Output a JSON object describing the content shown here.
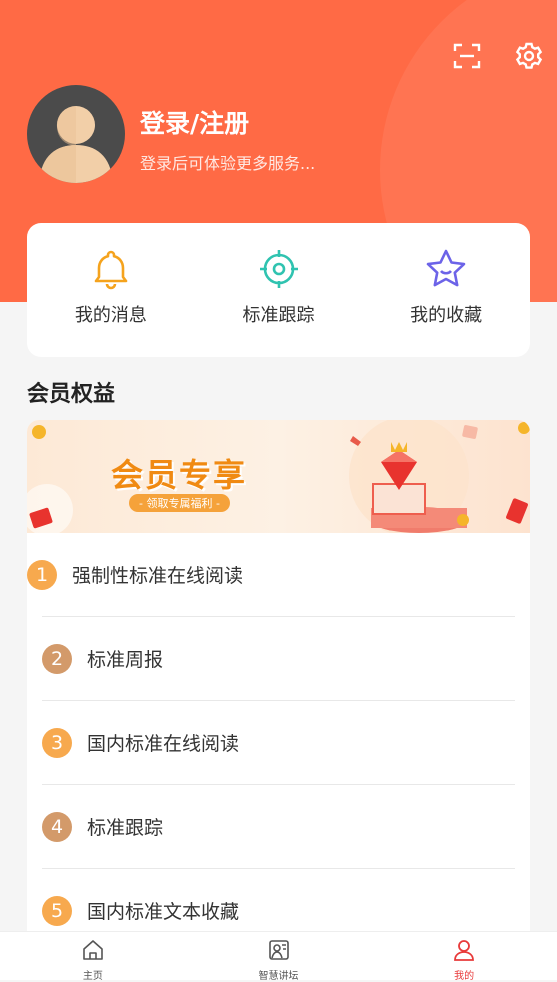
{
  "header": {
    "login_title": "登录/注册",
    "login_subtitle": "登录后可体验更多服务...",
    "scan_icon": "scan-icon",
    "settings_icon": "gear-icon"
  },
  "quick_actions": [
    {
      "label": "我的消息",
      "icon": "bell-icon"
    },
    {
      "label": "标准跟踪",
      "icon": "target-icon"
    },
    {
      "label": "我的收藏",
      "icon": "star-icon"
    }
  ],
  "member": {
    "title": "会员权益",
    "banner_title": "会员专享",
    "banner_subtitle": "- 领取专属福利 -",
    "items": [
      {
        "num": "1",
        "label": "强制性标准在线阅读",
        "color": "#f7a94e"
      },
      {
        "num": "2",
        "label": "标准周报",
        "color": "#d39a6a"
      },
      {
        "num": "3",
        "label": "国内标准在线阅读",
        "color": "#f7a94e"
      },
      {
        "num": "4",
        "label": "标准跟踪",
        "color": "#d39a6a"
      },
      {
        "num": "5",
        "label": "国内标准文本收藏",
        "color": "#f7a94e"
      }
    ]
  },
  "tabbar": [
    {
      "label": "主页",
      "icon": "home-icon",
      "active": false
    },
    {
      "label": "智慧讲坛",
      "icon": "lecture-icon",
      "active": false
    },
    {
      "label": "我的",
      "icon": "user-icon",
      "active": true
    }
  ],
  "colors": {
    "primary": "#ff6a45",
    "active_tab": "#e83a3a"
  }
}
